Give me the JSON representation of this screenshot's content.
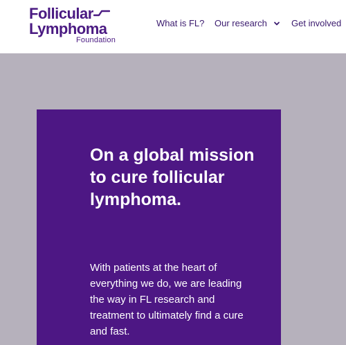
{
  "brand": {
    "logo_line1": "Follicular",
    "logo_line2": "Lymphoma",
    "logo_line3": "Foundation",
    "color": "#4a1a82"
  },
  "nav": {
    "items": [
      {
        "label": "What is FL?",
        "has_dropdown": false
      },
      {
        "label": "Our research",
        "has_dropdown": true
      },
      {
        "label": "Get involved",
        "has_dropdown": false
      }
    ],
    "color": "#3a1a6e"
  },
  "hero": {
    "title": "On a global mission to cure follicular lymphoma.",
    "text": "With patients at the heart of everything we do, we are leading the way in FL research and treatment to ultimately find a cure and fast.",
    "card_color": "#4d1784",
    "page_background": "#b6b1bc"
  }
}
